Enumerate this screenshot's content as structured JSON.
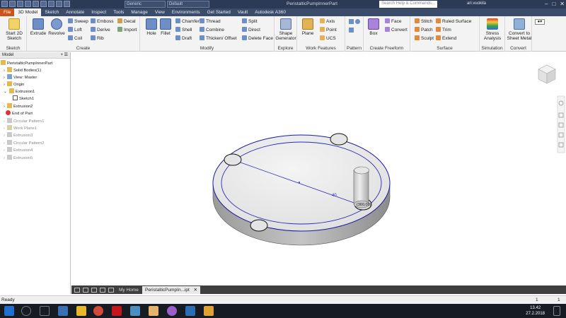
{
  "titlebar": {
    "material": "Generic",
    "appearance": "Default",
    "document": "PeristalticPumpInnerPart",
    "search_placeholder": "Search Help & Commands...",
    "user": "ari.vuokila"
  },
  "tabs": [
    "File",
    "3D Model",
    "Sketch",
    "Annotate",
    "Inspect",
    "Tools",
    "Manage",
    "View",
    "Environments",
    "Get Started",
    "Vault",
    "Autodesk A360"
  ],
  "ribbon": {
    "sketch": {
      "label": "Sketch",
      "start": "Start 2D Sketch"
    },
    "create": {
      "label": "Create",
      "extrude": "Extrude",
      "revolve": "Revolve",
      "sweep": "Sweep",
      "loft": "Loft",
      "coil": "Coil",
      "emboss": "Emboss",
      "derive": "Derive",
      "rib": "Rib",
      "decal": "Decal",
      "import": "Import"
    },
    "modify": {
      "label": "Modify",
      "hole": "Hole",
      "fillet": "Fillet",
      "chamfer": "Chamfer",
      "shell": "Shell",
      "draft": "Draft",
      "thread": "Thread",
      "combine": "Combine",
      "thicken": "Thicken/ Offset",
      "split": "Split",
      "direct": "Direct",
      "delete_face": "Delete Face"
    },
    "explore": {
      "label": "Explore",
      "shape_generator": "Shape Generator"
    },
    "work_features": {
      "label": "Work Features",
      "plane": "Plane",
      "axis": "Axis",
      "point": "Point",
      "ucs": "UCS"
    },
    "pattern": {
      "label": "Pattern"
    },
    "freeform": {
      "label": "Create Freeform",
      "box": "Box",
      "face": "Face",
      "convert": "Convert"
    },
    "surface": {
      "label": "Surface",
      "stitch": "Stitch",
      "patch": "Patch",
      "sculpt": "Sculpt",
      "ruled_surface": "Ruled Surface",
      "trim": "Trim",
      "extend": "Extend"
    },
    "simulation": {
      "label": "Simulation",
      "stress": "Stress Analysis"
    },
    "convert_grp": {
      "label": "Convert",
      "sheet_metal": "Convert to Sheet Metal"
    }
  },
  "browser": {
    "header": "Model",
    "items": [
      "PeristalticPumpInnerPart",
      "Solid Bodies(1)",
      "View: Master",
      "Origin",
      "Extrusion1",
      "Sketch1",
      "Extrusion2",
      "End of Part",
      "Circular Pattern1",
      "Work Plane1",
      "Extrusion3",
      "Circular Pattern2",
      "Extrusion4",
      "Extrusion5"
    ]
  },
  "viewport": {
    "dim_radius": "40",
    "dim_angle": "(360,00)"
  },
  "doctabs": {
    "home": "My Home",
    "doc": "PeristalticPumpIn...ipt"
  },
  "status": {
    "text": "Ready",
    "count1": "1",
    "count2": "1"
  },
  "clock": {
    "time": "13.42",
    "date": "27.2.2018"
  }
}
